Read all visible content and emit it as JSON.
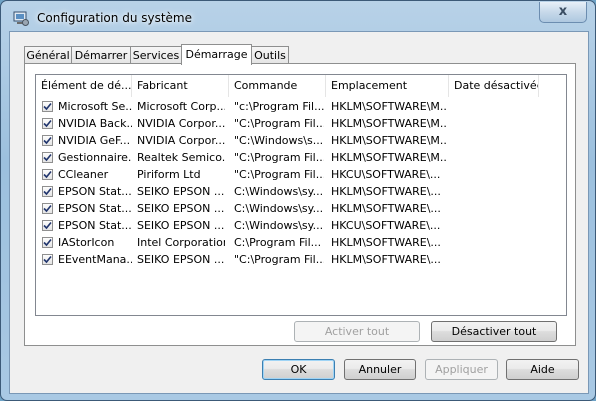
{
  "window": {
    "title": "Configuration du système",
    "close_glyph": "x",
    "icon": "system-config-icon"
  },
  "tabs": [
    {
      "label": "Général",
      "active": false
    },
    {
      "label": "Démarrer",
      "active": false
    },
    {
      "label": "Services",
      "active": false
    },
    {
      "label": "Démarrage",
      "active": true
    },
    {
      "label": "Outils",
      "active": false
    }
  ],
  "startup_list": {
    "columns": [
      "Élément de dé...",
      "Fabricant",
      "Commande",
      "Emplacement",
      "Date désactivée"
    ],
    "rows": [
      {
        "checked": true,
        "cells": [
          "Microsoft Se...",
          "Microsoft Corp...",
          "\"c:\\Program Fil...",
          "HKLM\\SOFTWARE\\M...",
          ""
        ]
      },
      {
        "checked": true,
        "cells": [
          "NVIDIA Back...",
          "NVIDIA Corpor...",
          "\"C:\\Program Fil...",
          "HKLM\\SOFTWARE\\M...",
          ""
        ]
      },
      {
        "checked": true,
        "cells": [
          "NVIDIA GeF...",
          "NVIDIA Corpor...",
          "\"C:\\Windows\\s...",
          "HKLM\\SOFTWARE\\M...",
          ""
        ]
      },
      {
        "checked": true,
        "cells": [
          "Gestionnaire...",
          "Realtek Semico...",
          "\"C:\\Program Fil...",
          "HKLM\\SOFTWARE\\M...",
          ""
        ]
      },
      {
        "checked": true,
        "cells": [
          "CCleaner",
          "Piriform Ltd",
          "\"C:\\Program Fil...",
          "HKCU\\SOFTWARE\\...",
          ""
        ]
      },
      {
        "checked": true,
        "cells": [
          "EPSON Stat...",
          "SEIKO EPSON ...",
          "C:\\Windows\\sy...",
          "HKLM\\SOFTWARE\\...",
          ""
        ]
      },
      {
        "checked": true,
        "cells": [
          "EPSON Stat...",
          "SEIKO EPSON ...",
          "C:\\Windows\\sy...",
          "HKLM\\SOFTWARE\\...",
          ""
        ]
      },
      {
        "checked": true,
        "cells": [
          "EPSON Stat...",
          "SEIKO EPSON ...",
          "C:\\Windows\\sy...",
          "HKCU\\SOFTWARE\\...",
          ""
        ]
      },
      {
        "checked": true,
        "cells": [
          "IAStorIcon",
          "Intel Corporation",
          "C:\\Program Fil...",
          "HKLM\\SOFTWARE\\...",
          ""
        ]
      },
      {
        "checked": true,
        "cells": [
          "EEventMana...",
          "SEIKO EPSON ...",
          "\"C:\\Program Fil...",
          "HKLM\\SOFTWARE\\...",
          ""
        ]
      }
    ]
  },
  "actions": {
    "enable_all": "Activer tout",
    "disable_all": "Désactiver tout"
  },
  "footer": {
    "ok": "OK",
    "cancel": "Annuler",
    "apply": "Appliquer",
    "help": "Aide"
  }
}
